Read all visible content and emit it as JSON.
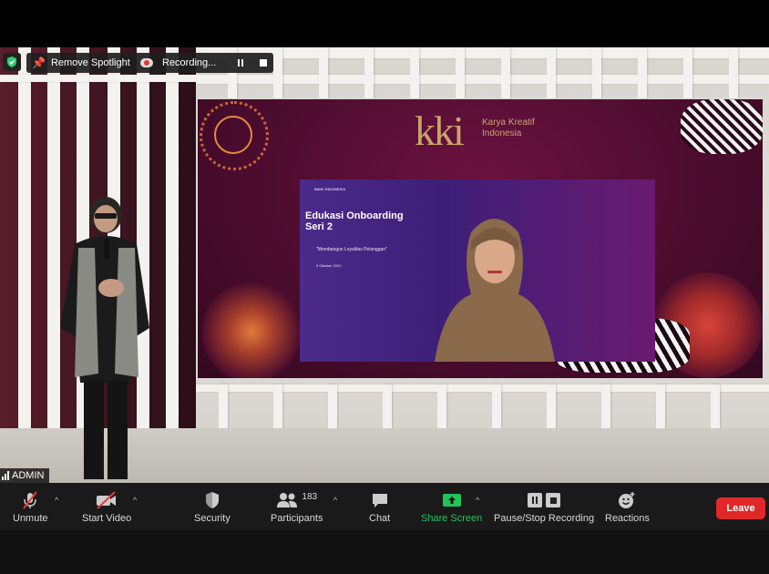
{
  "meeting": {
    "spotlight_label": "Remove Spotlight",
    "recording_label": "Recording...",
    "participant_name": "ADMIN"
  },
  "screen_content": {
    "logo_mark": "kki",
    "logo_text": "Karya Kreatif Indonesia",
    "slide_brand": "BANK INDONESIA",
    "slide_title": "Edukasi Onboarding Seri 2",
    "slide_subtitle": "\"Membangun Loyalitas Pelanggan\"",
    "slide_date": "9 Oktober 2020"
  },
  "toolbar": {
    "unmute_label": "Unmute",
    "start_video_label": "Start Video",
    "security_label": "Security",
    "participants_label": "Participants",
    "participants_count": "183",
    "chat_label": "Chat",
    "share_screen_label": "Share Screen",
    "pause_stop_label": "Pause/Stop Recording",
    "reactions_label": "Reactions",
    "leave_label": "Leave"
  },
  "colors": {
    "toolbar_bg": "#1a1a1a",
    "share_green": "#21c35b",
    "leave_red": "#e02828",
    "muted_red": "#e53935",
    "shield_green": "#2ecc71"
  }
}
